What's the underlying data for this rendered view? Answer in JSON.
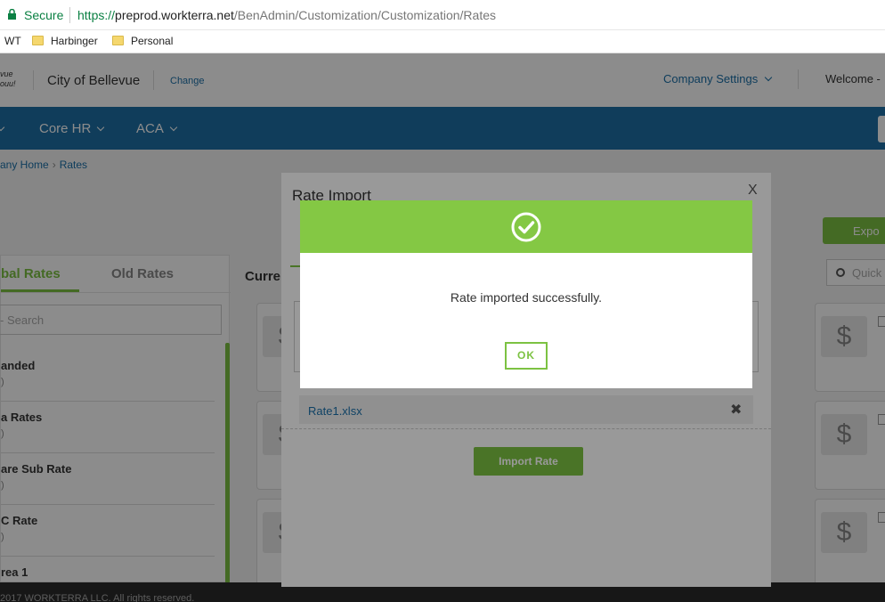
{
  "browser": {
    "secure_label": "Secure",
    "url_proto": "https://",
    "url_host": "preprod.workterra.net",
    "url_path": "/BenAdmin/Customization/Customization/Rates",
    "bookmarks": [
      "WT",
      "Harbinger",
      "Personal"
    ]
  },
  "header": {
    "company_name": "City of Bellevue",
    "change_link": "Change",
    "company_settings": "Company Settings",
    "welcome": "Welcome -"
  },
  "nav": {
    "items": [
      "Core HR",
      "ACA"
    ]
  },
  "breadcrumb": {
    "home": "any Home",
    "current": "Rates"
  },
  "left_panel": {
    "tab_global": "bal Rates",
    "tab_old": "Old Rates",
    "search_placeholder": "- Search",
    "items": [
      {
        "title": "anded",
        "sub": ")"
      },
      {
        "title": "a Rates",
        "sub": ")"
      },
      {
        "title": "are Sub Rate",
        "sub": ")"
      },
      {
        "title": "C Rate",
        "sub": ")"
      },
      {
        "title": "rea 1",
        "sub": ""
      }
    ]
  },
  "main": {
    "current_label": "Curre",
    "export_label": "Expo",
    "quick_search_placeholder": "Quick",
    "dollar_glyph": "$"
  },
  "import_modal": {
    "title": "Rate Import",
    "close_glyph": "X",
    "file_name": "Rate1.xlsx",
    "remove_glyph": "✖",
    "import_button": "Import Rate"
  },
  "success_dialog": {
    "message": "Rate imported successfully.",
    "ok_label": "OK",
    "accent_color": "#84c844"
  },
  "footer": {
    "text": "2017 WORKTERRA LLC. All rights reserved."
  }
}
